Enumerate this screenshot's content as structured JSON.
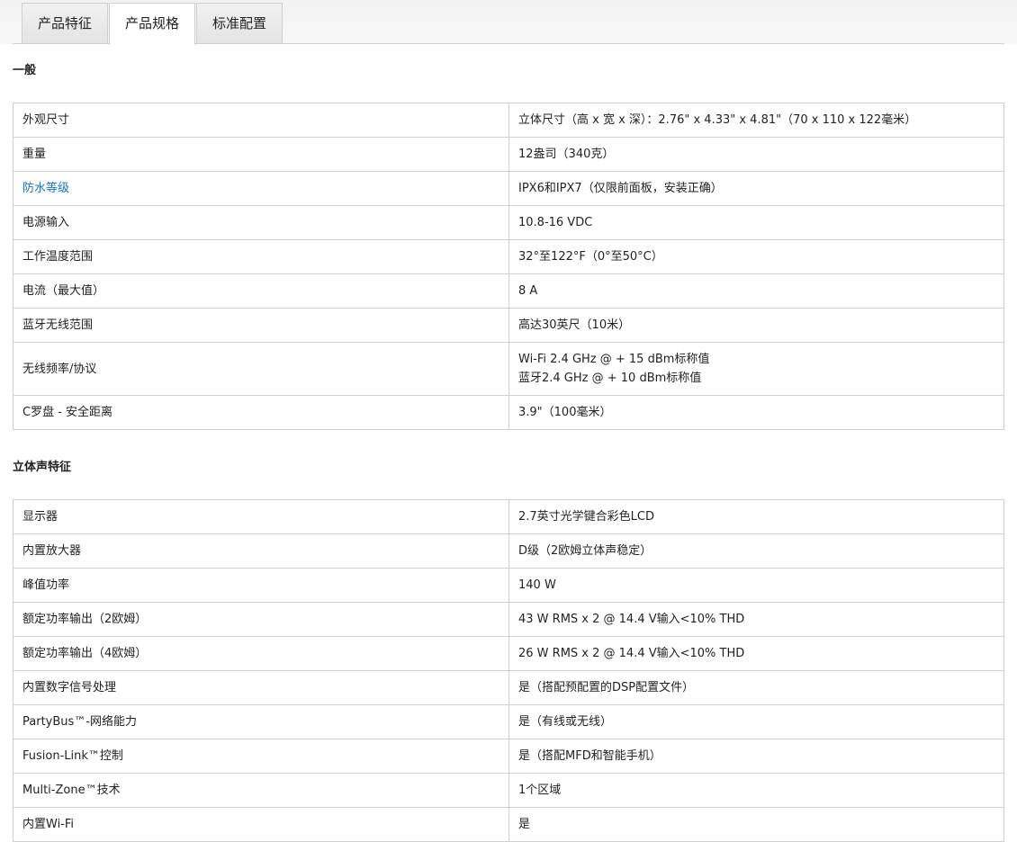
{
  "tabs": [
    {
      "label": "产品特征",
      "active": false
    },
    {
      "label": "产品规格",
      "active": true
    },
    {
      "label": "标准配置",
      "active": false
    }
  ],
  "general": {
    "title": "一般",
    "rows": [
      {
        "label": "外观尺寸",
        "value": "立体尺寸（高 x 宽 x 深）：2.76\" x 4.33\" x 4.81\"（70 x 110 x 122毫米）"
      },
      {
        "label": "重量",
        "value": "12盎司（340克）"
      },
      {
        "label": "防水等级",
        "value": "IPX6和IPX7（仅限前面板，安装正确）",
        "link": true
      },
      {
        "label": "电源输入",
        "value": "10.8-16 VDC"
      },
      {
        "label": "工作温度范围",
        "value": "32°至122°F（0°至50°C）"
      },
      {
        "label": "电流（最大值）",
        "value": "8 A"
      },
      {
        "label": "蓝牙无线范围",
        "value": "高达30英尺（10米）"
      },
      {
        "label": "无线频率/协议",
        "value_lines": [
          "Wi-Fi 2.4 GHz @ + 15 dBm标称值",
          "蓝牙2.4 GHz @ + 10 dBm标称值"
        ]
      },
      {
        "label": "C罗盘 - 安全距离",
        "value": "3.9\"（100毫米）"
      }
    ]
  },
  "stereo": {
    "title": "立体声特征",
    "rows": [
      {
        "label": "显示器",
        "value": "2.7英寸光学键合彩色LCD"
      },
      {
        "label": "内置放大器",
        "value": "D级（2欧姆立体声稳定）"
      },
      {
        "label": "峰值功率",
        "value": "140 W"
      },
      {
        "label": "额定功率输出（2欧姆）",
        "value": "43 W RMS x 2 @ 14.4 V输入<10% THD"
      },
      {
        "label": "额定功率输出（4欧姆）",
        "value": "26 W RMS x 2 @ 14.4 V输入<10% THD"
      },
      {
        "label": "内置数字信号处理",
        "value": "是（搭配预配置的DSP配置文件）"
      },
      {
        "label": "PartyBus™-网络能力",
        "value": "是（有线或无线）"
      },
      {
        "label": "Fusion-Link™控制",
        "value": "是（搭配MFD和智能手机）"
      },
      {
        "label": "Multi-Zone™技术",
        "value": "1个区域"
      },
      {
        "label": "内置Wi-Fi",
        "value": "是"
      }
    ]
  },
  "colors": {
    "link": "#1a73c8",
    "border": "#cfcfcf"
  }
}
